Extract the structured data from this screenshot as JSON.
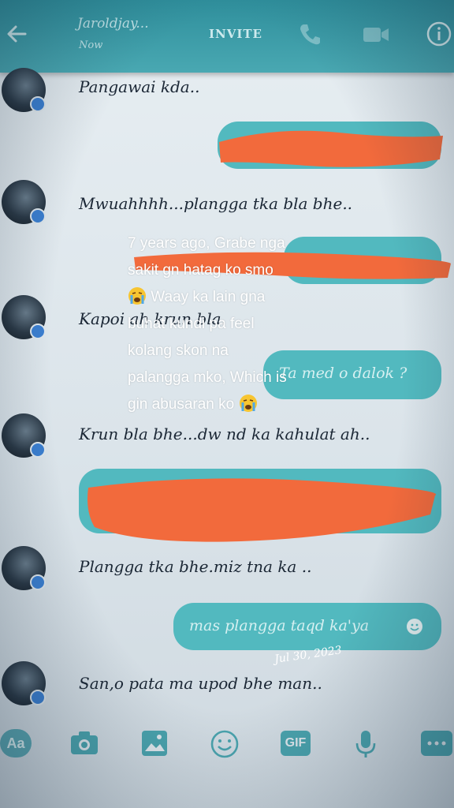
{
  "header": {
    "contact_name": "Jaroldjay...",
    "status": "Now",
    "invite_label": "INVITE",
    "accent": "#3a9aa5"
  },
  "messages": [
    {
      "side": "in",
      "text": "Pangawai kda.."
    },
    {
      "side": "out",
      "text": ""
    },
    {
      "side": "in",
      "text": "Mwuahhhh...plangga  tka bla bhe.."
    },
    {
      "side": "out",
      "text": ""
    },
    {
      "side": "in",
      "text": "Kapoi ah krun bla."
    },
    {
      "side": "out",
      "text": "Ta med o dalok ?"
    },
    {
      "side": "in",
      "text": "Krun bla bhe...dw nd ka kahulat ah.."
    },
    {
      "side": "out",
      "text": ""
    },
    {
      "side": "in",
      "text": "Plangga tka bhe.miz tna ka .."
    },
    {
      "side": "out",
      "text": "mas plangga taqd ka'ya"
    },
    {
      "side": "in",
      "text": "San,o pata ma upod bhe man.."
    }
  ],
  "overlay_caption": {
    "line1": "7 years ago, Grabe nga",
    "line2": "sakit gn hatag ko smo",
    "line3": "Waay ka lain gna",
    "line4": "buhat kundi pa feel",
    "line5": "kolang skon na",
    "line6": "palangga mko, Which is",
    "line7": "gin abusaran ko"
  },
  "date_stamp": "Jul 30, 2023",
  "toolbar": {
    "icons": [
      "aa-icon",
      "camera-icon",
      "gallery-icon",
      "emoji-icon",
      "gif-icon",
      "mic-icon",
      "more-icon"
    ],
    "aa_label": "Aa",
    "gif_label": "GIF"
  },
  "colors": {
    "bubble": "#52b9bf",
    "redaction": "#f26a3c"
  }
}
